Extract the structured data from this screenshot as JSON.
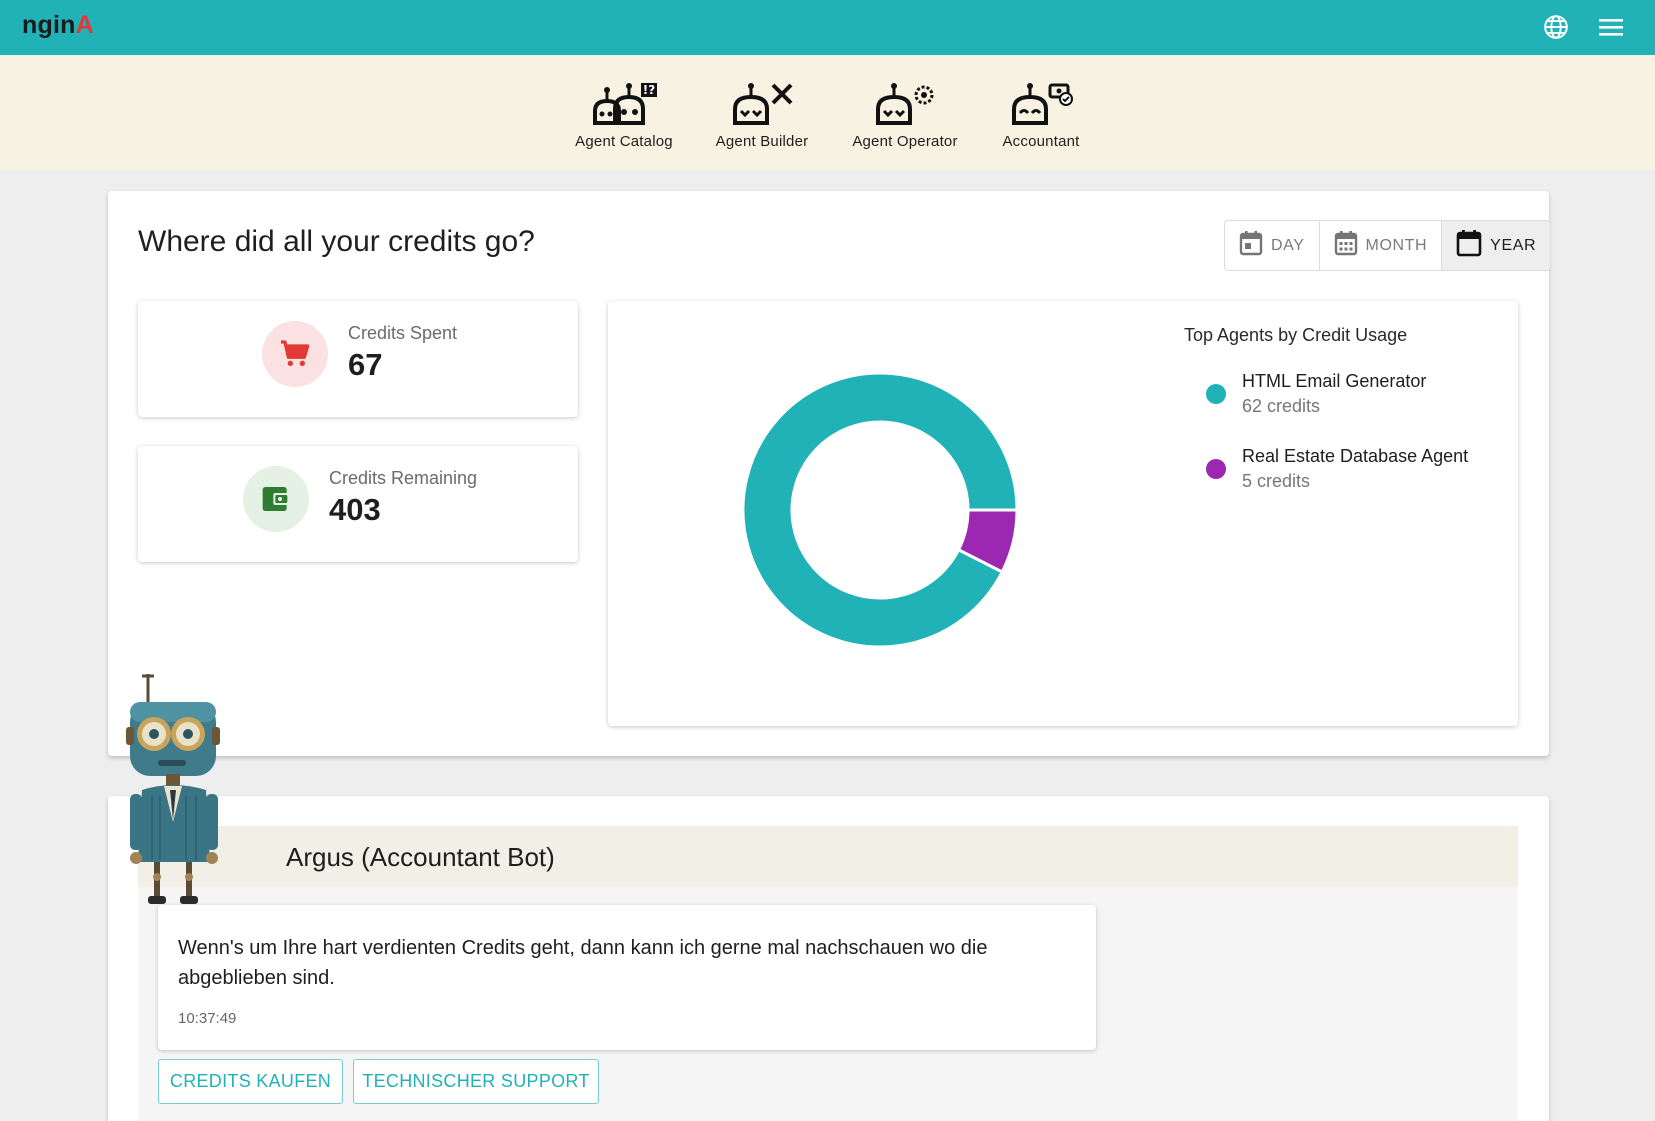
{
  "header": {
    "logo_main": "ngin",
    "logo_accent": "A",
    "language_icon": "globe-icon",
    "menu_icon": "hamburger-menu-icon"
  },
  "nav": {
    "items": [
      {
        "label": "Agent Catalog",
        "icon": "robots-catalog-icon",
        "active": false
      },
      {
        "label": "Agent Builder",
        "icon": "robot-tools-icon",
        "active": false
      },
      {
        "label": "Agent Operator",
        "icon": "robot-gear-icon",
        "active": false
      },
      {
        "label": "Accountant",
        "icon": "robot-money-icon",
        "active": true
      }
    ]
  },
  "overview": {
    "title": "Where did all your credits go?",
    "periods": [
      {
        "label": "DAY",
        "icon": "calendar-day-icon",
        "active": false
      },
      {
        "label": "MONTH",
        "icon": "calendar-month-icon",
        "active": false
      },
      {
        "label": "YEAR",
        "icon": "calendar-year-icon",
        "active": true
      }
    ],
    "spent": {
      "label": "Credits Spent",
      "value": "67",
      "icon": "cart-icon"
    },
    "remaining": {
      "label": "Credits Remaining",
      "value": "403",
      "icon": "wallet-icon"
    }
  },
  "chart_data": {
    "type": "pie",
    "title": "Top Agents by Credit Usage",
    "donut": true,
    "legend_position": "right",
    "categories": [
      "HTML Email Generator",
      "Real Estate Database Agent"
    ],
    "values": [
      62,
      5
    ],
    "value_labels": [
      "62 credits",
      "5 credits"
    ],
    "colors": [
      "#20b2b6",
      "#9c27b0"
    ]
  },
  "bot": {
    "name": "Argus (Accountant Bot)",
    "avatar": "robot-avatar",
    "message": "Wenn's um Ihre hart verdienten Credits geht, dann kann ich gerne mal nachschauen wo die abgeblieben sind.",
    "time": "10:37:49",
    "actions": [
      "CREDITS KAUFEN",
      "TECHNISCHER SUPPORT"
    ]
  },
  "colors": {
    "primary": "#20b2b6",
    "secondary": "#9c27b0",
    "nav_background": "#f7f2e2",
    "logo_accent": "#e53935"
  }
}
